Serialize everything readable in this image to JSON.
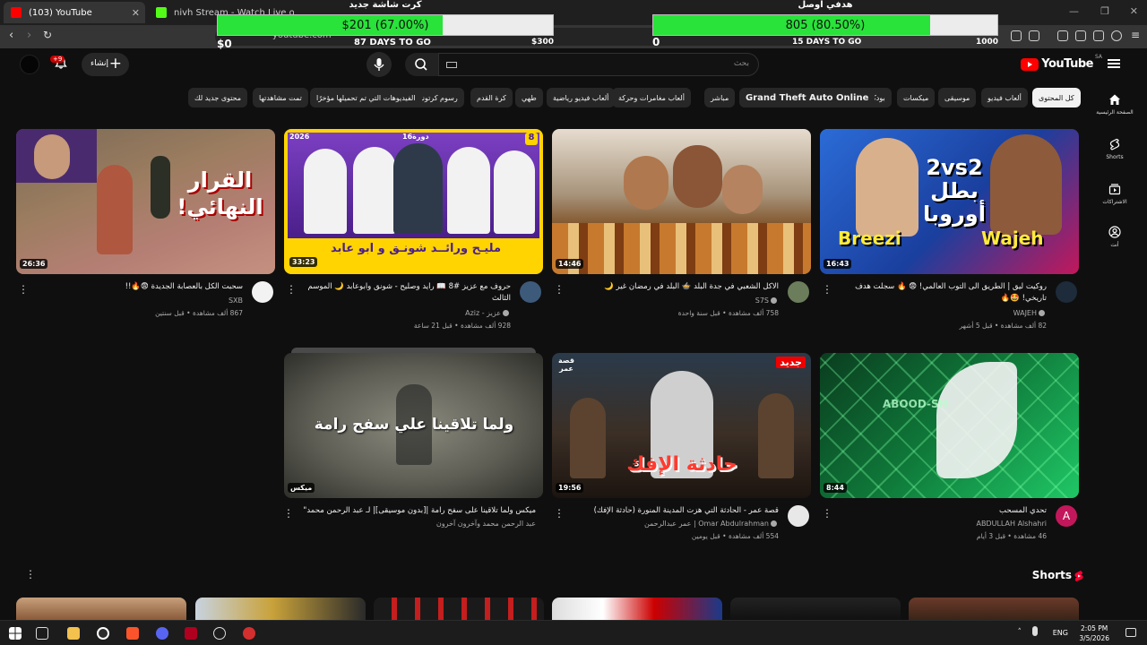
{
  "browser": {
    "tabs": [
      {
        "title": "(103) YouTube",
        "active": true
      },
      {
        "title": "nivh Stream - Watch Live on Kick",
        "active": false
      }
    ],
    "url": "youtube.com"
  },
  "overlay": {
    "goal1": {
      "title": "كرت شاشة جديد",
      "value": "$201 (67.00%)",
      "progress": 0.67,
      "subtitle": "87 DAYS TO GO",
      "start": "$0",
      "end": "$300"
    },
    "goal2": {
      "title": "هدفي اوصل",
      "value": "805 (80.50%)",
      "progress": 0.805,
      "subtitle": "15 DAYS TO GO",
      "start": "0",
      "end": "1000"
    }
  },
  "header": {
    "logo": "YouTube",
    "region": "SA",
    "search_placeholder": "بحث",
    "create_label": "إنشاء",
    "notif_count": "+9"
  },
  "chips": [
    "كل المحتوى",
    "ألعاب فيديو",
    "موسيقى",
    "ميكسات",
    "بودكاست",
    "Grand Theft Auto Online",
    "مباشر",
    "ألعاب مغامرات وحركة",
    "ألعاب فيديو رياضية",
    "طهي",
    "كرة القدم",
    "رسوم كرتونية",
    "الفيديوهات التي تم تحميلها مؤخرًا",
    "تمت مشاهدتها",
    "محتوى جديد لك"
  ],
  "rail": [
    {
      "label": "الصفحة الرئيسية",
      "icon": "home-icon"
    },
    {
      "label": "Shorts",
      "icon": "shorts-icon"
    },
    {
      "label": "الاشتراكات",
      "icon": "subscriptions-icon"
    },
    {
      "label": "أنت",
      "icon": "you-icon"
    }
  ],
  "videos": [
    {
      "title": "روكيت ليق | الطريق الى التوب العالمي! 😨 🔥 سجلت هدف تاريخي! 🤩🔥",
      "channel": "WAJEH",
      "meta": "82 ألف مشاهدة • قبل 5 أشهر",
      "duration": "16:43",
      "thumb_text": "2vs2 بطل أوروبا",
      "thumb_left": "Breezi",
      "thumb_right": "Wajeh"
    },
    {
      "title": "الاكل الشعبي في جدة البلد 🍲 البلد في رمضان غير 🌙",
      "channel": "S7S",
      "meta": "758 ألف مشاهدة • قبل سنة واحدة",
      "duration": "14:46"
    },
    {
      "title": "حروف مع عزيز #8 📖 رايد وصليح - شونق وابوعابد 🌙 الموسم الثالث",
      "channel": "Aziz - عزيز",
      "meta": "928 ألف مشاهدة • قبل 21 ساعة",
      "duration": "33:23",
      "thumb_text": "مليـح ورائــد شونـق و ابو عابد",
      "thumb_badge": "8",
      "thumb_year": "2026",
      "thumb_round": "دورة16"
    },
    {
      "title": "سحبت الكل بالعصابة الجديدة 😨🔥!!",
      "channel": "SXB",
      "meta": "867 ألف مشاهدة • قبل سنتين",
      "duration": "26:36",
      "thumb_text": "القرار النهائي!"
    },
    {
      "title": "تحدي المسحب",
      "channel": "ABDULLAH Alshahri",
      "meta": "46 مشاهدة • قبل 3 أيام",
      "duration": "8:44",
      "avatar_letter": "A",
      "thumb_text": "ABOOD-SH"
    },
    {
      "title": "قصة عمر - الحادثة التي هزت المدينة المنورة (حادثة الإفك)",
      "channel": "عمر عبدالرحمن | Omar Abdulrahman",
      "meta": "554 ألف مشاهدة • قبل يومين",
      "duration": "19:56",
      "thumb_text": "حادثة الإفك",
      "thumb_badge": "جديد",
      "thumb_corner": "قصة عمر"
    },
    {
      "title": "ميكس ولما تلاقينا على سفح رامة |[بدون موسيقى]| لـ عبد الرحمن محمد\"",
      "channel": "عبد الرحمن محمد وآخرون آخرون",
      "meta": "",
      "duration": "ميكس",
      "thumb_text": "ولما تلاقينا علي سفح رامة"
    }
  ],
  "shorts_label": "Shorts",
  "taskbar": {
    "lang": "ENG",
    "time": "2:05 PM",
    "date": "3/5/2026"
  },
  "colors": {
    "accent": "#ff0000",
    "bg": "#0f0f0f",
    "goal_fill": "#29e23a"
  }
}
